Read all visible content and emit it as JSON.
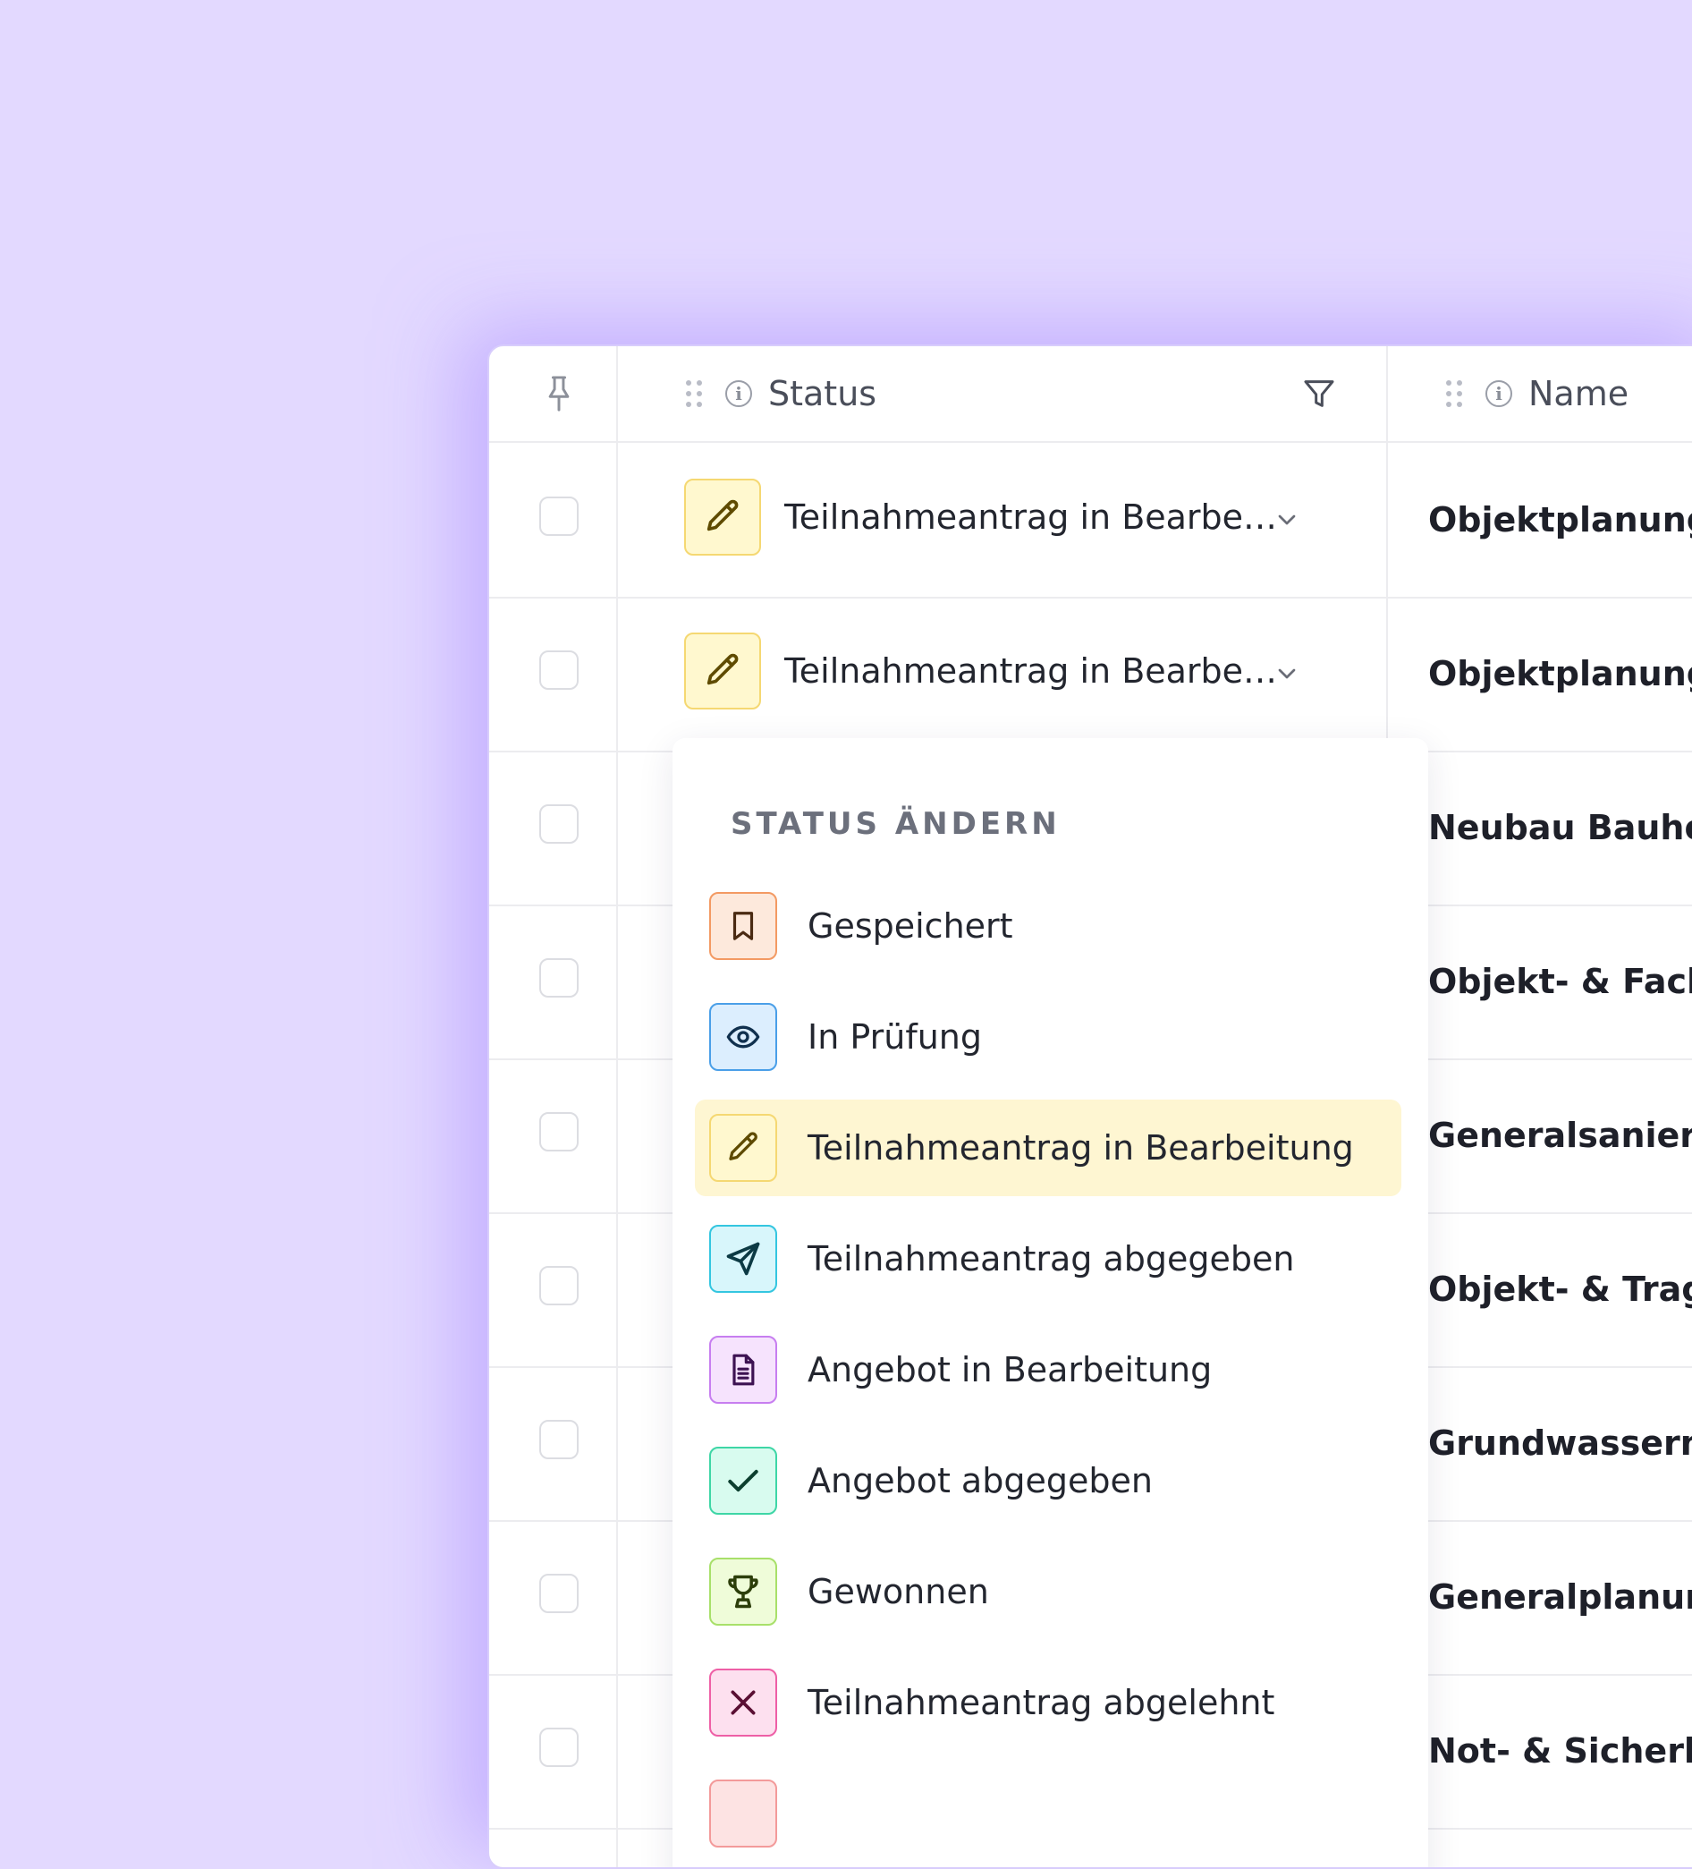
{
  "header": {
    "status_label": "Status",
    "name_label": "Name"
  },
  "rows": [
    {
      "status": "Teilnahmeantrag in Bearbe…",
      "name": "Objektplanung (L"
    },
    {
      "status": "Teilnahmeantrag in Bearbe…",
      "name": "Objektplanung (L"
    },
    {
      "name": "Neubau Bauhof ("
    },
    {
      "name": "Objekt- & Fachpl"
    },
    {
      "name": "Generalsanierun"
    },
    {
      "name": "Objekt- & Tragwe"
    },
    {
      "name": "Grundwassermo"
    },
    {
      "name": "Generalplanung"
    },
    {
      "name": "Not- & Sicherheit"
    }
  ],
  "dropdown": {
    "title": "STATUS ÄNDERN",
    "items": [
      {
        "label": "Gespeichert",
        "icon": "bookmark-icon",
        "color": "#f39a63",
        "bg": "#fde9dc"
      },
      {
        "label": "In Prüfung",
        "icon": "eye-icon",
        "color": "#4a9fe8",
        "bg": "#dceefe"
      },
      {
        "label": "Teilnahmeantrag in Bearbeitung",
        "icon": "pencil-icon",
        "color": "#f5d872",
        "bg": "#fff8cf",
        "selected": true
      },
      {
        "label": "Teilnahmeantrag abgegeben",
        "icon": "send-icon",
        "color": "#34c6e0",
        "bg": "#d8f6fb"
      },
      {
        "label": "Angebot in Bearbeitung",
        "icon": "document-icon",
        "color": "#c77ef0",
        "bg": "#f6e3fd"
      },
      {
        "label": "Angebot abgegeben",
        "icon": "check-icon",
        "color": "#3ed6a6",
        "bg": "#d8fbef"
      },
      {
        "label": "Gewonnen",
        "icon": "trophy-icon",
        "color": "#a8e06a",
        "bg": "#effcd9"
      },
      {
        "label": "Teilnahmeantrag abgelehnt",
        "icon": "close-icon",
        "color": "#ee5fa6",
        "bg": "#fde0ef"
      }
    ]
  }
}
